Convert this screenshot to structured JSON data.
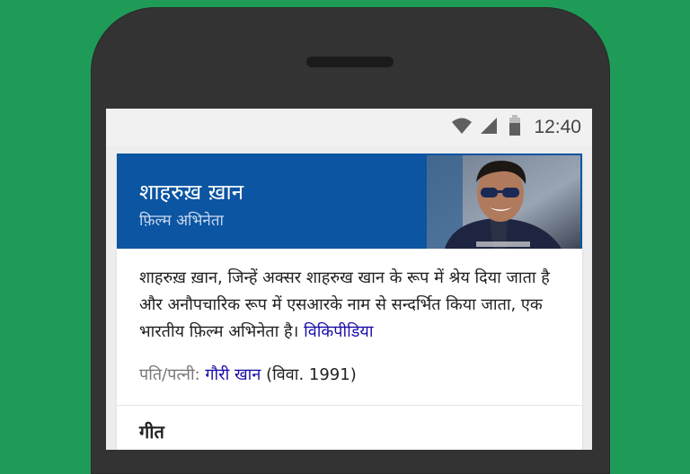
{
  "status_bar": {
    "time": "12:40",
    "icons": [
      "wifi-icon",
      "signal-icon",
      "battery-icon"
    ]
  },
  "card": {
    "title": "शाहरुख़ ख़ान",
    "subtitle": "फ़िल्म अभिनेता",
    "photo": "portrait-photo",
    "description": "शाहरुख़ ख़ान, जिन्हें अक्सर शाहरुख खान के रूप में श्रेय दिया जाता है और अनौपचारिक रूप में एसआरके नाम से सन्दर्भित किया जाता, एक भारतीय फ़िल्म अभिनेता है।",
    "source_link": "विकिपीडिया",
    "spouse": {
      "label": "पति/पत्नी:",
      "name": "गौरी खान",
      "detail": "(विवा. 1991)"
    },
    "next_section": "गीत"
  },
  "colors": {
    "background": "#1e9c57",
    "header": "#0b55a2",
    "link": "#1a0dab"
  }
}
